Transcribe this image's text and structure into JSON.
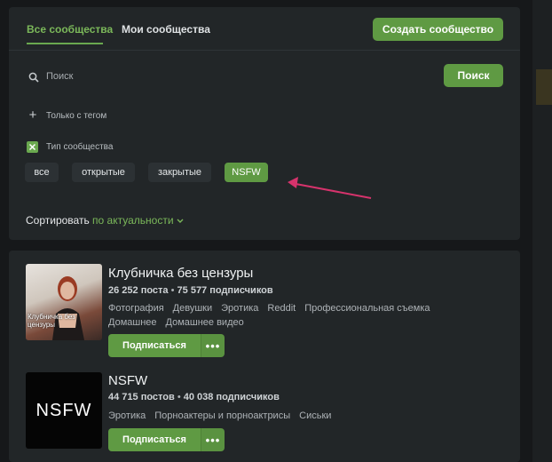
{
  "tabs": {
    "all": "Все сообщества",
    "mine": "Мои сообщества"
  },
  "create_button": "Создать сообщество",
  "search": {
    "placeholder": "Поиск",
    "button": "Поиск"
  },
  "filters": {
    "tag_only": "Только с тегом",
    "community_type": "Тип сообщества"
  },
  "type_chips": [
    {
      "label": "все",
      "selected": false
    },
    {
      "label": "открытые",
      "selected": false
    },
    {
      "label": "закрытые",
      "selected": false
    },
    {
      "label": "NSFW",
      "selected": true
    }
  ],
  "sort": {
    "label": "Сортировать",
    "value": "по актуальности"
  },
  "communities": [
    {
      "title": "Клубничка без цензуры",
      "posts": "26 252 поста",
      "subscribers": "75 577 подписчиков",
      "thumb_caption": "Клубничка без цензуры",
      "tags": [
        "Фотография",
        "Девушки",
        "Эротика",
        "Reddit",
        "Профессиональная съемка",
        "Домашнее",
        "Домашнее видео"
      ],
      "subscribe_label": "Подписаться",
      "more_label": "•••"
    },
    {
      "title": "NSFW",
      "posts": "44 715 постов",
      "subscribers": "40 038 подписчиков",
      "thumb_caption": "NSFW",
      "tags": [
        "Эротика",
        "Порноактеры и порноактрисы",
        "Сиськи"
      ],
      "subscribe_label": "Подписаться",
      "more_label": "•••"
    }
  ],
  "colors": {
    "accent": "#5f9a43",
    "accent_text": "#7bb85a",
    "annotation_arrow": "#d6336c"
  }
}
